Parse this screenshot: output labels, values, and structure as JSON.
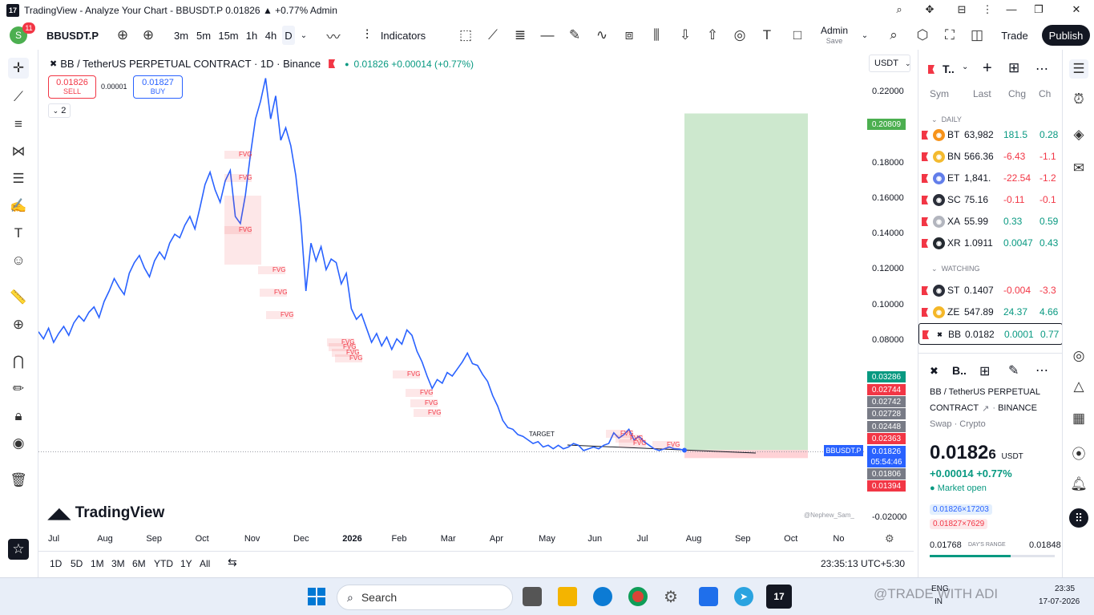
{
  "window": {
    "title": "TradingView - Analyze Your Chart - BBUSDT.P 0.01826 ▲ +0.77% Admin",
    "logo": "17",
    "controls": [
      "search-icon",
      "extensions-icon",
      "bookmark-icon",
      "menu-icon",
      "minimize-icon",
      "restore-icon",
      "close-icon"
    ]
  },
  "toolbar": {
    "avatar_letter": "S",
    "notifications": "11",
    "symbol": "BBUSDT.P",
    "intervals": [
      "3m",
      "5m",
      "15m",
      "1h",
      "4h",
      "D"
    ],
    "indicators_label": "Indicators",
    "layout_name": "Admin",
    "layout_sub": "Save",
    "trade_label": "Trade",
    "publish_label": "Publish"
  },
  "legend": {
    "title": "BB / TetherUS PERPETUAL CONTRACT · 1D · Binance",
    "price_change": "0.01826 +0.00014 (+0.77%)",
    "sell_price": "0.01826",
    "sell_label": "SELL",
    "spread": "0.00001",
    "buy_price": "0.01827",
    "buy_label": "BUY",
    "indicators_count": "2",
    "currency": "USDT"
  },
  "chart_data": {
    "type": "line",
    "symbol": "BBUSDT.P",
    "yticks": [
      "0.22000",
      "0.20000",
      "0.18000",
      "0.16000",
      "0.14000",
      "0.12000",
      "0.10000",
      "0.08000",
      "-0.02000"
    ],
    "ylim": [
      -0.025,
      0.235
    ],
    "xticks": [
      "Jul",
      "Aug",
      "Sep",
      "Oct",
      "Nov",
      "Dec",
      "2026",
      "Feb",
      "Mar",
      "Apr",
      "May",
      "Jun",
      "Jul",
      "Aug",
      "Sep",
      "Oct",
      "No"
    ],
    "series": [
      {
        "values": [
          0.085,
          0.081,
          0.087,
          0.079,
          0.084,
          0.088,
          0.083,
          0.09,
          0.094,
          0.091,
          0.096,
          0.099,
          0.093,
          0.102,
          0.108,
          0.115,
          0.11,
          0.106,
          0.118,
          0.124,
          0.128,
          0.121,
          0.116,
          0.125,
          0.13,
          0.126,
          0.135,
          0.14,
          0.138,
          0.145,
          0.15,
          0.143,
          0.155,
          0.168,
          0.175,
          0.165,
          0.158,
          0.17,
          0.176,
          0.15,
          0.146,
          0.162,
          0.185,
          0.205,
          0.215,
          0.228,
          0.205,
          0.218,
          0.193,
          0.2,
          0.19,
          0.173,
          0.147,
          0.108,
          0.135,
          0.125,
          0.133,
          0.12,
          0.126,
          0.124,
          0.112,
          0.118,
          0.098,
          0.092,
          0.095,
          0.087,
          0.079,
          0.084,
          0.077,
          0.082,
          0.075,
          0.081,
          0.078,
          0.086,
          0.083,
          0.074,
          0.068,
          0.06,
          0.053,
          0.058,
          0.056,
          0.062,
          0.06,
          0.064,
          0.068,
          0.073,
          0.067,
          0.066,
          0.061,
          0.057,
          0.049,
          0.043,
          0.035,
          0.031,
          0.03,
          0.027,
          0.026,
          0.024,
          0.022,
          0.023,
          0.02,
          0.021,
          0.019,
          0.021,
          0.019,
          0.02,
          0.022,
          0.021,
          0.018,
          0.019,
          0.02,
          0.019,
          0.021,
          0.022,
          0.028,
          0.025,
          0.027,
          0.03,
          0.024,
          0.026,
          0.023,
          0.021,
          0.019,
          0.018,
          0.019,
          0.02,
          0.019,
          0.0188,
          0.0182
        ]
      }
    ],
    "position": {
      "target": "0.20809",
      "entry": "0.01826",
      "stop": "0.01394"
    },
    "price_tags": [
      {
        "value": "0.20809",
        "color": "#4caf50"
      },
      {
        "value": "0.03286",
        "color": "#089981"
      },
      {
        "value": "0.02744",
        "color": "#f23645"
      },
      {
        "value": "0.02742",
        "color": "#787b86"
      },
      {
        "value": "0.02728",
        "color": "#787b86"
      },
      {
        "value": "0.02448",
        "color": "#787b86"
      },
      {
        "value": "0.02363",
        "color": "#f23645"
      },
      {
        "value": "0.01826",
        "color": "#2962ff"
      },
      {
        "value": "05:54:46",
        "color": "#2962ff"
      },
      {
        "value": "0.01806",
        "color": "#787b86"
      },
      {
        "value": "0.01394",
        "color": "#f23645"
      }
    ],
    "symbol_tag": "BBUSDT.P",
    "fvg_label": "FVG",
    "target_label": "TARGET",
    "watermark": "TradingView",
    "author": "@Nephew_Sam_"
  },
  "bottombar": {
    "ranges": [
      "1D",
      "5D",
      "1M",
      "3M",
      "6M",
      "YTD",
      "1Y",
      "All"
    ],
    "clock": "23:35:13 UTC+5:30"
  },
  "watchlist": {
    "title": "T..",
    "columns": [
      "Sym",
      "Last",
      "Chg",
      "Ch"
    ],
    "daily_label": "DAILY",
    "watching_label": "WATCHING",
    "daily": [
      {
        "sym": "BT",
        "last": "63,982",
        "chg": "181.5",
        "chp": "0.28",
        "dir": "up",
        "coin": "#f7931a"
      },
      {
        "sym": "BN",
        "last": "566.36",
        "chg": "-6.43",
        "chp": "-1.1",
        "dir": "down",
        "coin": "#f3ba2f"
      },
      {
        "sym": "ET",
        "last": "1,841.",
        "chg": "-22.54",
        "chp": "-1.2",
        "dir": "down",
        "coin": "#627eea"
      },
      {
        "sym": "SC",
        "last": "75.16",
        "chg": "-0.11",
        "chp": "-0.1",
        "dir": "down",
        "coin": "#2a2e39"
      },
      {
        "sym": "XA",
        "last": "55.99",
        "chg": "0.33",
        "chp": "0.59",
        "dir": "up",
        "coin": "#b2b5be"
      },
      {
        "sym": "XR",
        "last": "1.0911",
        "chg": "0.0047",
        "chp": "0.43",
        "dir": "up",
        "coin": "#23292f"
      }
    ],
    "watching": [
      {
        "sym": "ST",
        "last": "0.1407",
        "chg": "-0.004",
        "chp": "-3.3",
        "dir": "down",
        "coin": "#2a2e39"
      },
      {
        "sym": "ZE",
        "last": "547.89",
        "chg": "24.37",
        "chp": "4.66",
        "dir": "up",
        "coin": "#f4b728"
      },
      {
        "sym": "BB",
        "last": "0.0182",
        "chg": "0.0001",
        "chp": "0.77",
        "dir": "up",
        "coin": "#ffffff"
      }
    ]
  },
  "details": {
    "symbol": "B..",
    "name": "BB / TetherUS PERPETUAL",
    "name2": "CONTRACT",
    "exchange": "BINANCE",
    "type": "Swap · Crypto",
    "price": "0.0182",
    "price_last": "6",
    "currency": "USDT",
    "change": "+0.00014 +0.77%",
    "status": "Market open",
    "bid": "0.01826×17203",
    "ask": "0.01827×7629",
    "range_low": "0.01768",
    "range_label": "DAY'S RANGE",
    "range_high": "0.01848",
    "range_progress": 0.65
  },
  "taskbar": {
    "search_placeholder": "Search",
    "lang": "ENG",
    "region": "IN",
    "time": "23:35",
    "date": "17-07-2026",
    "watermark": "@TRADE WITH ADI"
  },
  "colors": {
    "line": "#2962ff",
    "profit_zone": "#c8e6c9",
    "loss_zone": "#ffcdd2",
    "fvg": "#f23645"
  }
}
